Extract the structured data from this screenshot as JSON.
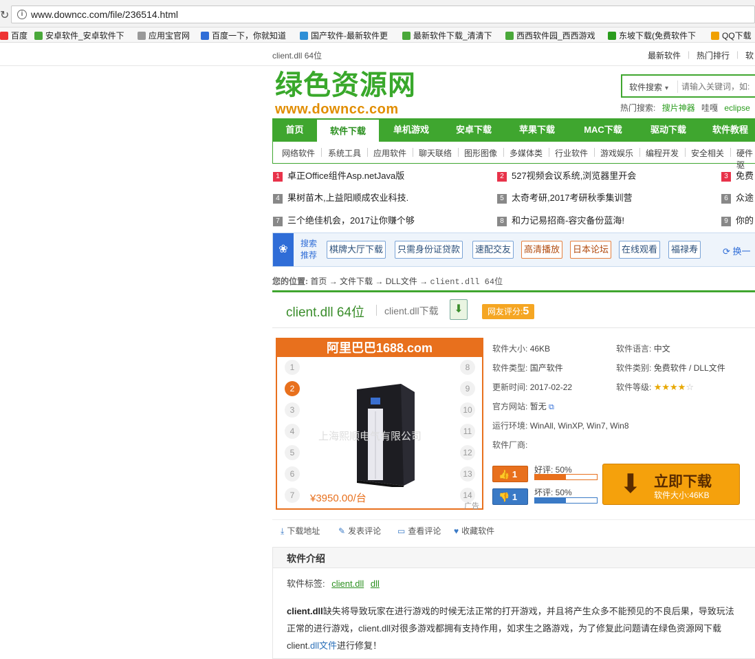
{
  "browser": {
    "url": "www.downcc.com/file/236514.html",
    "bookmarks": [
      {
        "label": "百度",
        "color": "#e33"
      },
      {
        "label": "安卓软件_安卓软件下",
        "color": "#4aa83a"
      },
      {
        "label": "应用宝官网",
        "color": "#999"
      },
      {
        "label": "百度一下，你就知道",
        "color": "#2f6dd7"
      },
      {
        "label": "国产软件-最新软件更",
        "color": "#2f8fd6"
      },
      {
        "label": "最新软件下载_清清下",
        "color": "#4aa83a"
      },
      {
        "label": "西西软件园_西西游戏",
        "color": "#4aa83a"
      },
      {
        "label": "东坡下载(免费软件下",
        "color": "#2a9c1d"
      },
      {
        "label": "QQ下载",
        "color": "#f0a000"
      }
    ]
  },
  "topbar": {
    "title": "client.dll 64位",
    "links": [
      "最新软件",
      "热门排行",
      "软"
    ]
  },
  "logo": {
    "cn": "绿色资源网",
    "en": "www.downcc.com"
  },
  "search": {
    "select": "软件搜索",
    "placeholder": "请输入关键词，如:"
  },
  "hot": {
    "label": "热门搜索:",
    "items": [
      "搜片神器",
      "哇嘎",
      "eclipse"
    ]
  },
  "nav": [
    "首页",
    "软件下载",
    "单机游戏",
    "安卓下载",
    "苹果下载",
    "MAC下载",
    "驱动下载",
    "软件教程"
  ],
  "subnav": [
    "网络软件",
    "系统工具",
    "应用软件",
    "聊天联络",
    "图形图像",
    "多媒体类",
    "行业软件",
    "游戏娱乐",
    "编程开发",
    "安全相关",
    "硬件驱"
  ],
  "news": [
    {
      "n": "1",
      "t": "卓正Office组件Asp.netJava版",
      "red": true
    },
    {
      "n": "2",
      "t": "527视频会议系统,浏览器里开会",
      "red": true
    },
    {
      "n": "3",
      "t": "免费",
      "red": true
    },
    {
      "n": "4",
      "t": "果树苗木,上益阳顺成农业科技.",
      "red": false
    },
    {
      "n": "5",
      "t": "太奇考研,2017考研秋季集训营",
      "red": false
    },
    {
      "n": "6",
      "t": "众途",
      "red": false
    },
    {
      "n": "7",
      "t": "三个绝佳机会，2017让你赚个够",
      "red": false
    },
    {
      "n": "8",
      "t": "和力记易招商-容灾备份蓝海!",
      "red": false
    },
    {
      "n": "9",
      "t": "你的",
      "red": false
    }
  ],
  "recommend": {
    "label1": "搜索",
    "label2": "推荐",
    "buttons": [
      "棋牌大厅下载",
      "只需身份证贷款",
      "速配交友",
      "高清播放",
      "日本论坛",
      "在线观看",
      "福禄寿"
    ],
    "change": "换一"
  },
  "breadcrumb": {
    "label": "您的位置:",
    "items": [
      "首页",
      "文件下载",
      "DLL文件",
      "client.dll 64位"
    ],
    "arrow": "→"
  },
  "title": {
    "main": "client.dll 64位",
    "sub": "client.dll下载",
    "rating_label": "网友评分:",
    "rating": "5"
  },
  "ad": {
    "header": "阿里巴巴1688.com",
    "left_nums": [
      "1",
      "2",
      "3",
      "4",
      "5",
      "6",
      "7"
    ],
    "right_nums": [
      "8",
      "9",
      "10",
      "11",
      "12",
      "13",
      "14"
    ],
    "active": "2",
    "watermark": "上海熙顺电气有限公司",
    "price": "¥3950.00/台",
    "ad_label": "广告"
  },
  "info": {
    "size": {
      "k": "软件大小:",
      "v": "46KB"
    },
    "lang": {
      "k": "软件语言:",
      "v": "中文"
    },
    "type": {
      "k": "软件类型:",
      "v": "国产软件"
    },
    "cat": {
      "k": "软件类别:",
      "v": "免费软件 / DLL文件"
    },
    "update": {
      "k": "更新时间:",
      "v": "2017-02-22"
    },
    "level": {
      "k": "软件等级:",
      "stars": 4,
      "max": 5
    },
    "site": {
      "k": "官方网站:",
      "v": "暂无"
    },
    "env": {
      "k": "运行环境:",
      "v": "WinAll, WinXP, Win7, Win8"
    },
    "vendor": {
      "k": "软件厂商:",
      "v": ""
    }
  },
  "votes": {
    "good": {
      "count": "1",
      "label": "好评: 50%",
      "pct": 0.5,
      "color": "#e8701d"
    },
    "bad": {
      "count": "1",
      "label": "坏评: 50%",
      "pct": 0.5,
      "color": "#3a7ac6"
    }
  },
  "download": {
    "label": "立即下载",
    "size": "软件大小:46KB"
  },
  "actions": [
    "下载地址",
    "发表评论",
    "查看评论",
    "收藏软件"
  ],
  "intro": {
    "heading": "软件介绍",
    "tags_label": "软件标签:",
    "tags": [
      "client.dll",
      "dll"
    ],
    "p_bold": "client.dll",
    "p_text1": "缺失将导致玩家在进行游戏的时候无法正常的打开游戏，并且将产生众多不能预见的不良后果，导致玩法正常的进行游戏，client.dll对很多游戏都拥有支持作用，如求生之路游戏，为了修复此问题请在绿色资源网下载client.",
    "p_link": "dll文件",
    "p_text2": "进行修复！"
  },
  "colors": {
    "brand_green": "#3fa62f",
    "accent_orange": "#e8701d",
    "link_blue": "#2f6dd7"
  }
}
